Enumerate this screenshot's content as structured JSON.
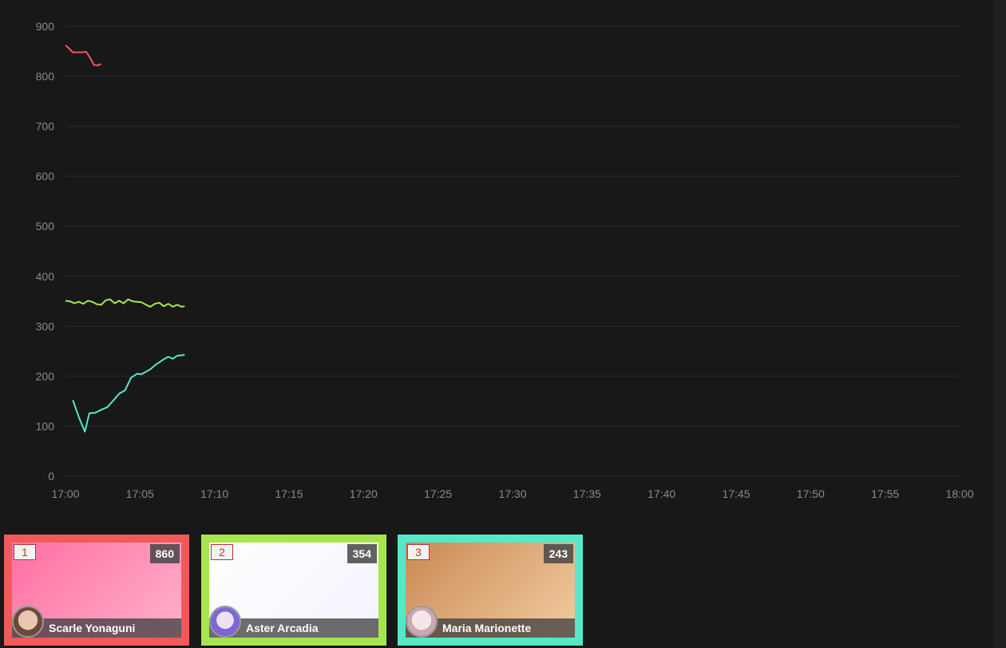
{
  "chart_data": {
    "type": "line",
    "x_ticks": [
      "17:00",
      "17:05",
      "17:10",
      "17:15",
      "17:20",
      "17:25",
      "17:30",
      "17:35",
      "17:40",
      "17:45",
      "17:50",
      "17:55",
      "18:00"
    ],
    "y_ticks": [
      "0",
      "100",
      "200",
      "300",
      "400",
      "500",
      "600",
      "700",
      "800",
      "900"
    ],
    "ylim": [
      0,
      900
    ],
    "xlim_minutes_after_1700": [
      0,
      60
    ],
    "grid": true,
    "series": [
      {
        "color": "#f05a5a",
        "x_minutes": [
          0.0,
          0.2,
          0.5,
          0.8,
          1.1,
          1.4,
          1.7,
          1.9,
          2.2,
          2.4
        ],
        "y": [
          862,
          857,
          848,
          848,
          848,
          849,
          835,
          823,
          822,
          825
        ]
      },
      {
        "color": "#a6e64c",
        "x_minutes": [
          0.0,
          0.3,
          0.6,
          0.9,
          1.2,
          1.5,
          1.8,
          2.1,
          2.4,
          2.7,
          3.0,
          3.3,
          3.6,
          3.9,
          4.2,
          4.5,
          4.8,
          5.1,
          5.4,
          5.7,
          6.0,
          6.3,
          6.6,
          6.9,
          7.2,
          7.5,
          7.8,
          8.0
        ],
        "y": [
          351,
          350,
          346,
          349,
          345,
          351,
          349,
          344,
          343,
          352,
          354,
          346,
          351,
          346,
          354,
          350,
          349,
          348,
          343,
          339,
          345,
          347,
          340,
          345,
          339,
          343,
          339,
          340
        ]
      },
      {
        "color": "#55e8c8",
        "x_minutes": [
          0.5,
          0.9,
          1.3,
          1.6,
          2.0,
          2.4,
          2.8,
          3.2,
          3.6,
          4.0,
          4.4,
          4.8,
          5.1,
          5.4,
          5.7,
          6.0,
          6.3,
          6.6,
          6.9,
          7.2,
          7.5,
          7.8,
          8.0
        ],
        "y": [
          152,
          118,
          89,
          126,
          127,
          133,
          138,
          151,
          165,
          172,
          197,
          205,
          204,
          209,
          214,
          222,
          228,
          234,
          239,
          235,
          241,
          242,
          243
        ]
      }
    ]
  },
  "cards": [
    {
      "rank": "1",
      "count": "860",
      "name": "Scarle Yonaguni",
      "frame": "#f05a5a",
      "bg_a": "#ff6fa3",
      "bg_b": "#ffb1cc"
    },
    {
      "rank": "2",
      "count": "354",
      "name": "Aster Arcadia",
      "frame": "#a6e64c",
      "bg_a": "#ffffff",
      "bg_b": "#f3f3ff"
    },
    {
      "rank": "3",
      "count": "243",
      "name": "Maria Marionette",
      "frame": "#55e8c8",
      "bg_a": "#c98a55",
      "bg_b": "#f3cba0"
    }
  ]
}
